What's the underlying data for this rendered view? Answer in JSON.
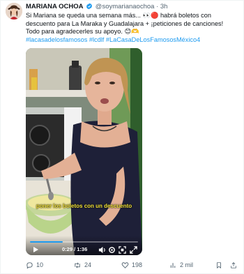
{
  "author": {
    "name": "MARIANA OCHOA",
    "handle": "@soymarianaochoa",
    "separator": "·",
    "time": "3h"
  },
  "tweet": {
    "text": "Si Mariana se queda una semana más... 👀🔴 habrá boletos con descuento para La Maraka y Guadalajara + ¡peticiones de canciones! Todo para agradecerles su apoyo. 😊🫶",
    "hashtags": "#lacasadelosfamosos #lcdlf #LaCasaDeLosFamososMéxico4"
  },
  "video": {
    "caption": "poner los boletos con un descuento",
    "time_display": "0:29 / 1:36",
    "progress": 0.3,
    "accent_color": "#1d9bf0"
  },
  "actions": {
    "replies": "10",
    "reposts": "24",
    "likes": "198",
    "views": "2 mil"
  },
  "icons": [
    "verified-icon",
    "play-icon",
    "volume-icon",
    "settings-icon",
    "fullscreen-icon",
    "expand-icon",
    "reply-icon",
    "repost-icon",
    "like-icon",
    "views-icon",
    "bookmark-icon",
    "share-icon"
  ]
}
